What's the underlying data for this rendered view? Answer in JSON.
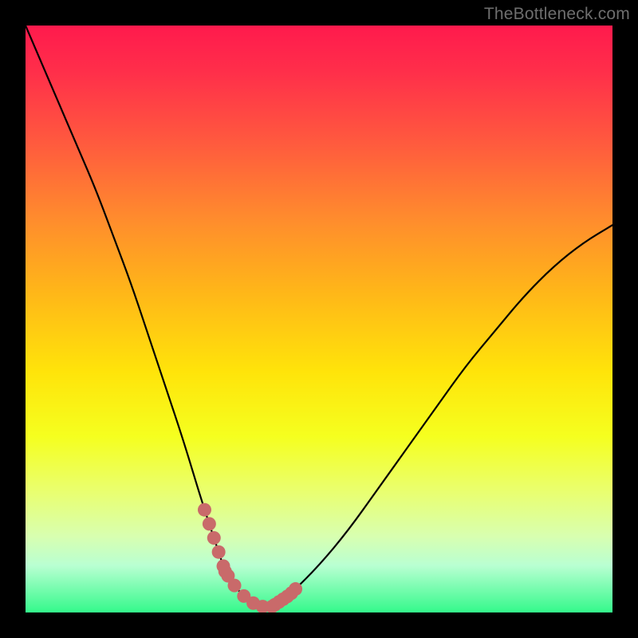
{
  "watermark": "TheBottleneck.com",
  "chart_data": {
    "type": "line",
    "title": "",
    "xlabel": "",
    "ylabel": "",
    "xlim": [
      0,
      100
    ],
    "ylim": [
      0,
      100
    ],
    "series": [
      {
        "name": "bottleneck-curve",
        "x": [
          0,
          3,
          6,
          9,
          12,
          15,
          18,
          21,
          24,
          27,
          30,
          33,
          34,
          36,
          38,
          40,
          42,
          45,
          50,
          55,
          60,
          65,
          70,
          75,
          80,
          85,
          90,
          95,
          100
        ],
        "y": [
          100,
          93,
          86,
          79,
          72,
          64,
          56,
          47,
          38,
          29,
          19,
          10,
          7,
          4,
          2,
          1,
          1,
          3,
          8,
          14,
          21,
          28,
          35,
          42,
          48,
          54,
          59,
          63,
          66
        ]
      }
    ],
    "markers": [
      {
        "name": "left-cluster",
        "x_range": [
          30.5,
          34.5
        ],
        "y_range": [
          3,
          14
        ]
      },
      {
        "name": "bottom-flat",
        "x_range": [
          34.0,
          42.0
        ],
        "y_range": [
          0.5,
          3
        ]
      },
      {
        "name": "right-cluster",
        "x_range": [
          42.5,
          46.0
        ],
        "y_range": [
          3,
          10
        ]
      }
    ],
    "colors": {
      "curve": "#000000",
      "marker": "#c96a6a",
      "gradient_top": "#ff1a4d",
      "gradient_mid": "#ffe40a",
      "gradient_bottom": "#34f98b",
      "frame": "#000000"
    }
  }
}
